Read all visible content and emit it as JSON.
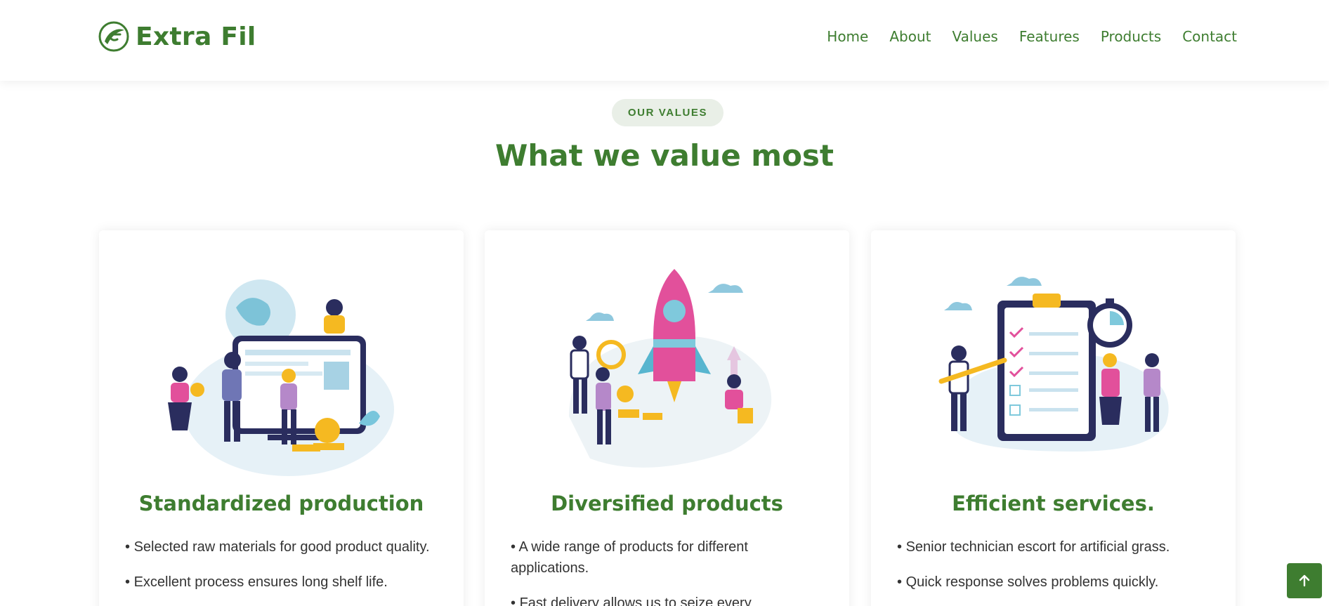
{
  "brand": {
    "name": "Extra Fil",
    "logo_icon": "leaf-globe-logo"
  },
  "nav": {
    "items": [
      "Home",
      "About",
      "Values",
      "Features",
      "Products",
      "Contact"
    ]
  },
  "section": {
    "badge": "OUR VALUES",
    "title": "What we value most"
  },
  "cards": [
    {
      "title": "Standardized production",
      "illustration": "team-with-globe-and-dashboard-illustration",
      "bullets": [
        "Selected raw materials for good product quality.",
        "Excellent process ensures long shelf life."
      ]
    },
    {
      "title": "Diversified products",
      "illustration": "rocket-launch-illustration",
      "bullets": [
        "A wide range of products for different applications.",
        "Fast delivery allows us to seize every"
      ]
    },
    {
      "title": "Efficient services.",
      "illustration": "checklist-and-stopwatch-illustration",
      "bullets": [
        "Senior technician escort for artificial grass.",
        "Quick response solves problems quickly."
      ]
    }
  ],
  "back_to_top": {
    "icon": "arrow-up-icon"
  },
  "colors": {
    "brand_green": "#3e7d30",
    "badge_bg": "#e9efe7",
    "text": "#333333"
  }
}
